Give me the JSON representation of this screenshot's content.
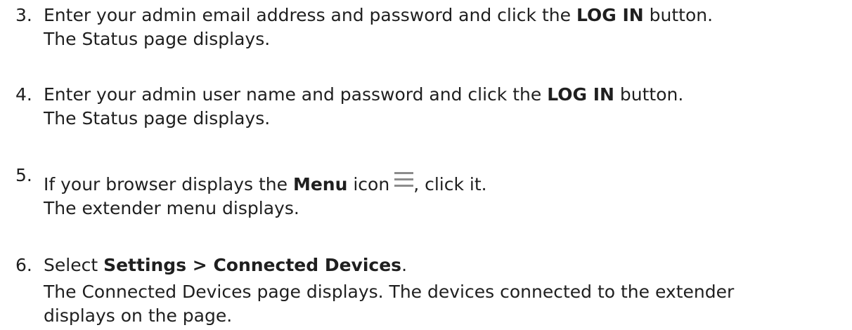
{
  "steps": [
    {
      "number": "3.",
      "line1_pre": "Enter your admin email address and password and click the ",
      "line1_bold": "LOG IN",
      "line1_post": " button.",
      "line2": "The Status page displays."
    },
    {
      "number": "4.",
      "line1_pre": "Enter your admin user name and password and click the ",
      "line1_bold": "LOG IN",
      "line1_post": " button.",
      "line2": "The Status page displays."
    },
    {
      "number": "5.",
      "line1_pre": "If your browser displays the ",
      "line1_bold": "Menu",
      "line1_mid": " icon",
      "line1_post": ", click it.",
      "icon": "menu-icon",
      "line2": "The extender menu displays."
    },
    {
      "number": "6.",
      "line1_pre": "Select ",
      "line1_bold": "Settings > Connected Devices",
      "line1_post": ".",
      "line2": "The Connected Devices page displays. The devices connected to the extender",
      "line3": "displays on the page."
    }
  ]
}
